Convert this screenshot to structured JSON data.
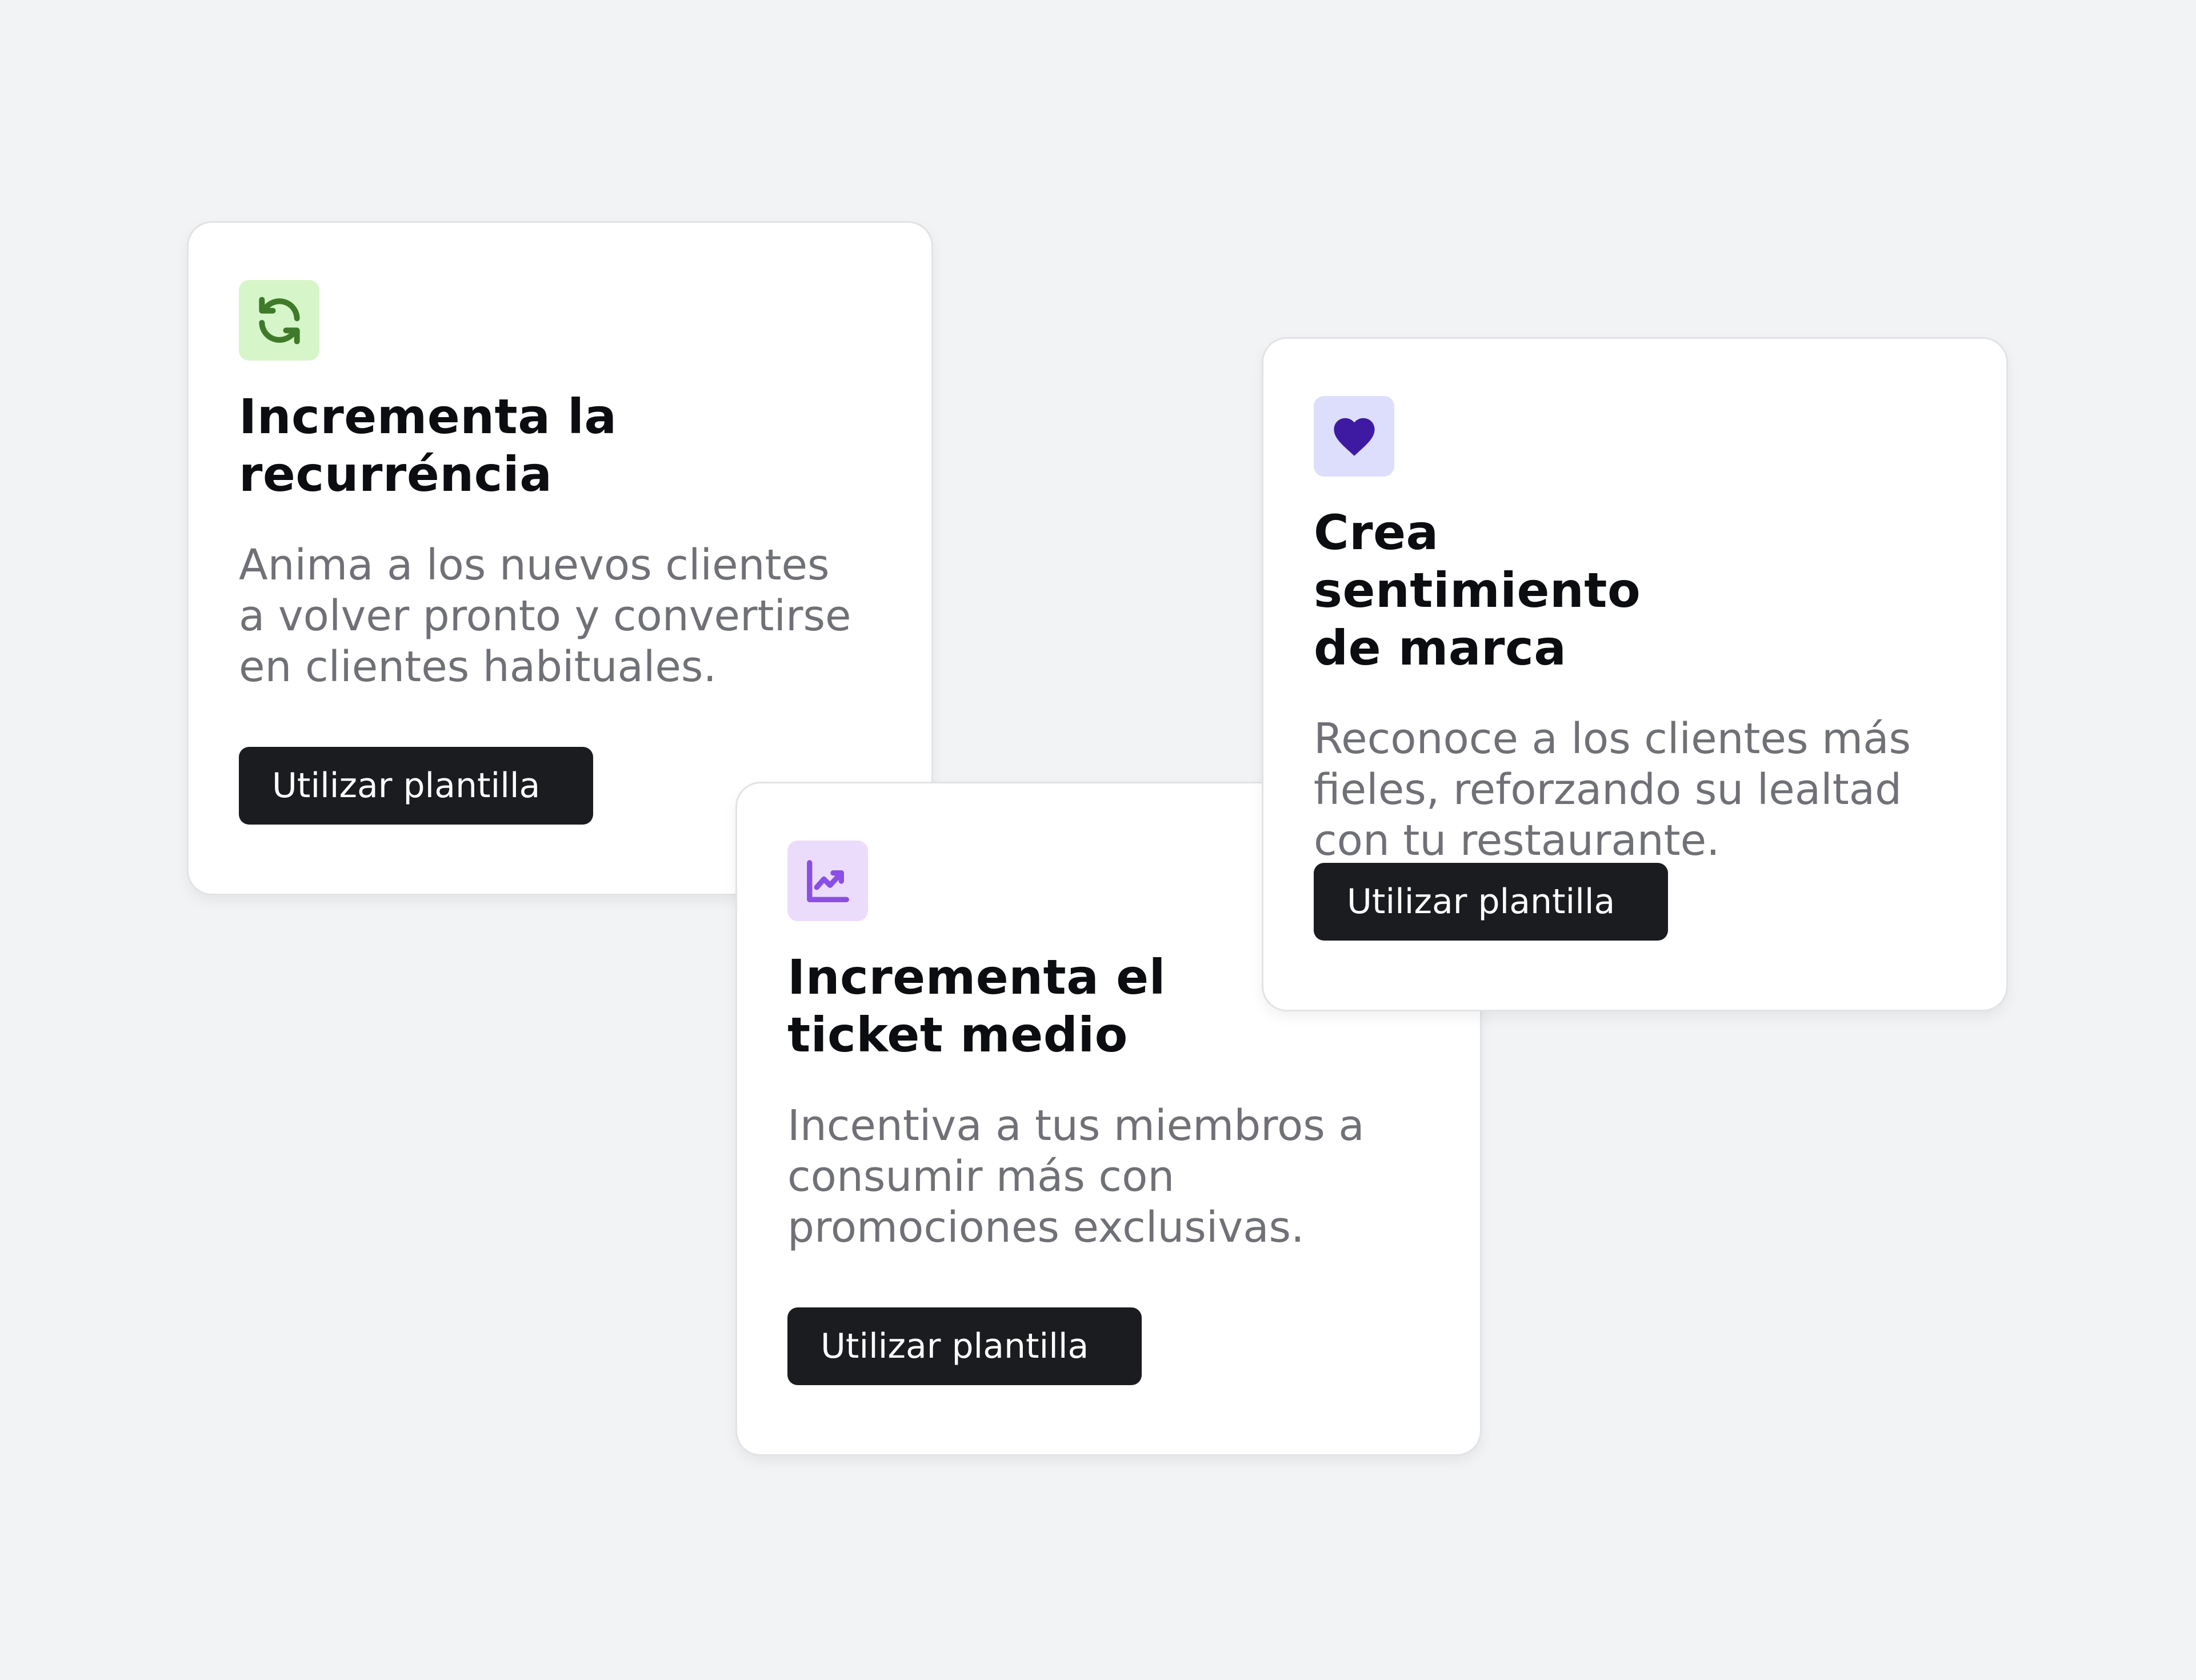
{
  "colors": {
    "page_background": "#f2f3f5",
    "button_background": "#1b1c1f",
    "title_text": "#0c0d10",
    "description_text": "#707176"
  },
  "cards": [
    {
      "icon": "refresh-icon",
      "icon_color": "#3f7a2a",
      "icon_background": "#d6f5c9",
      "title_lines": [
        "Incrementa la",
        "recurréncia"
      ],
      "description_lines": [
        "Anima a los nuevos clientes",
        "a volver pronto y convertirse",
        "en clientes habituales."
      ],
      "button_label": "Utilizar plantilla"
    },
    {
      "icon": "trending-up-chart-icon",
      "icon_color": "#8a4fe6",
      "icon_background": "#ecdcfc",
      "title_lines": [
        "Incrementa el",
        "ticket medio"
      ],
      "description_lines": [
        "Incentiva a tus miembros a",
        "consumir más con",
        "promociones exclusivas."
      ],
      "button_label": "Utilizar plantilla"
    },
    {
      "icon": "heart-icon",
      "icon_color": "#3e1aa3",
      "icon_background": "#dcdefb",
      "title_lines": [
        "Crea sentimiento",
        "de marca"
      ],
      "description_lines": [
        "Reconoce a los clientes más",
        "fieles, reforzando su lealtad",
        "con tu restaurante."
      ],
      "button_label": "Utilizar plantilla"
    }
  ]
}
